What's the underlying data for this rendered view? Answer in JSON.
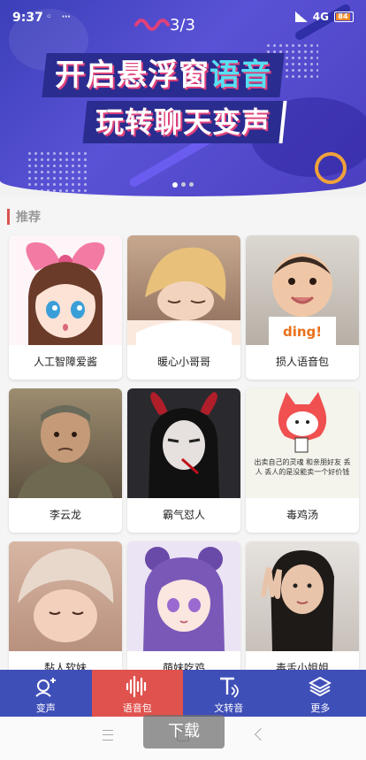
{
  "status": {
    "time": "9:37",
    "network": "4G",
    "battery": "84"
  },
  "banner": {
    "page_indicator": "3/3",
    "line1_part1": "开启悬浮窗",
    "line1_part2": "语音",
    "line2": "玩转聊天变声",
    "accent_color": "#58e0f2"
  },
  "section": {
    "title": "推荐"
  },
  "cards": [
    {
      "label": "人工智障爱酱",
      "icon": "anime-girl-bow"
    },
    {
      "label": "暖心小哥哥",
      "icon": "anime-boy-sleeping"
    },
    {
      "label": "损人语音包",
      "icon": "baby-ding",
      "badge": "ding!"
    },
    {
      "label": "李云龙",
      "icon": "soldier-portrait"
    },
    {
      "label": "霸气怼人",
      "icon": "horned-girl"
    },
    {
      "label": "毒鸡汤",
      "icon": "cat-comic",
      "comic_text": "出卖自己的灵魂 和亲朋好友 丢人 丢人的是没能卖一个好价钱"
    },
    {
      "label": "黏人软妹",
      "icon": "girl-hat"
    },
    {
      "label": "萌妹吃鸡",
      "icon": "anime-girl-purple"
    },
    {
      "label": "毒舌小姐姐",
      "icon": "girl-peace-sign"
    }
  ],
  "tabs": [
    {
      "label": "变声",
      "icon": "voice-change-icon"
    },
    {
      "label": "语音包",
      "icon": "waveform-icon",
      "active": true
    },
    {
      "label": "文转音",
      "icon": "text-to-speech-icon"
    },
    {
      "label": "更多",
      "icon": "layers-icon"
    }
  ],
  "overlay": {
    "download_label": "下载"
  },
  "colors": {
    "tab_bg": "#3f4fb8",
    "tab_active": "#e0524e",
    "banner": "#4a3fbf"
  }
}
